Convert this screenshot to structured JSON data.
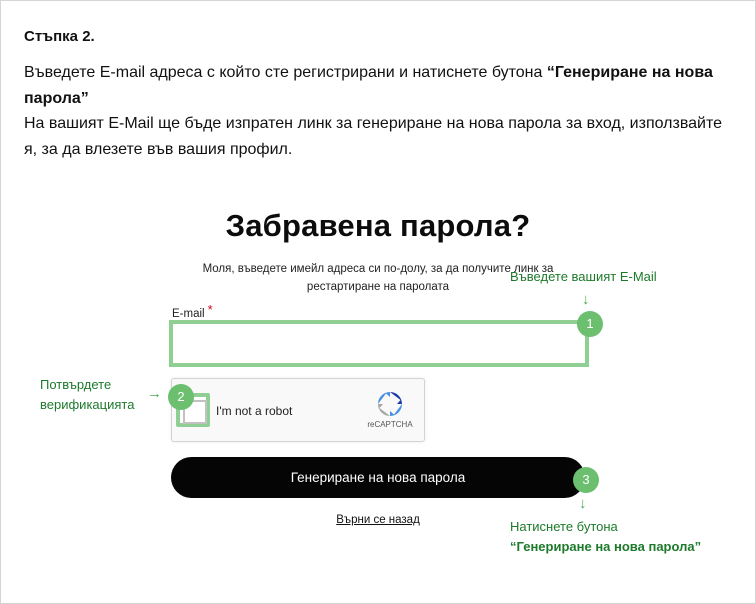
{
  "step": {
    "title": "Стъпка 2.",
    "line1_prefix": "Въведете E-mail адреса с който сте регистрирани и натиснете бутона ",
    "line1_bold": "“Генериране на нова парола”",
    "line2": "На вашият E-Mail ще бъде изпратен линк за генериране на нова парола за вход, използвайте я, за да влезете във вашия профил."
  },
  "form": {
    "title": "Забравена парола?",
    "subtitle": "Моля, въведете имейл адреса си по-долу, за да получите линк за рестартиране на паролата",
    "email_label": "E-mail",
    "required_mark": "*",
    "email_value": "",
    "captcha_text": "I'm not a robot",
    "captcha_brand": "reCAPTCHA",
    "submit_label": "Генериране на нова парола",
    "back_label": "Върни се назад"
  },
  "annotations": {
    "step1": {
      "badge": "1",
      "text": "Въведете вашият E-Mail"
    },
    "step2": {
      "badge": "2",
      "text": "Потвърдете верификацията"
    },
    "step3": {
      "badge": "3",
      "text": "Натиснете бутона",
      "bold": "“Генериране на нова парола”"
    }
  },
  "colors": {
    "accent_green": "#6cbf6f",
    "annotation_text": "#1d7a2b",
    "button_bg": "#050505",
    "required": "#d0021b"
  },
  "icons": {
    "arrow_down": "↓",
    "arrow_right": "→",
    "recaptcha": "recaptcha-icon"
  }
}
